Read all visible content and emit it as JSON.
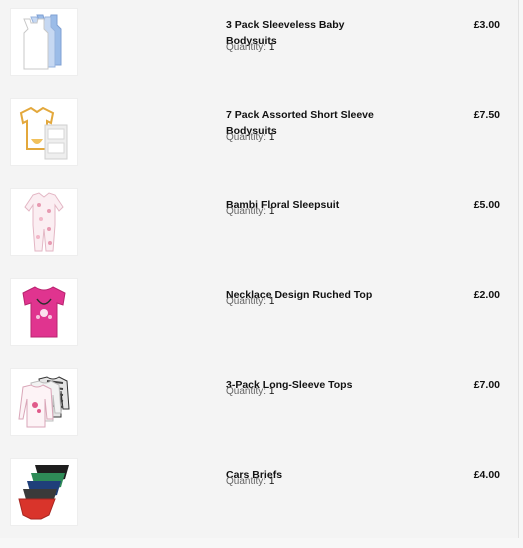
{
  "order": {
    "items": [
      {
        "name": "3 Pack Sleeveless Baby Bodysuits",
        "quantity_label": "Quantity:",
        "quantity": "1",
        "price": "£3.00",
        "image_icon": "white-blue-bodysuits-image"
      },
      {
        "name": "7 Pack Assorted Short Sleeve Bodysuits",
        "quantity_label": "Quantity:",
        "quantity": "1",
        "price": "£7.50",
        "image_icon": "short-sleeve-bodysuits-image"
      },
      {
        "name": "Bambi Floral Sleepsuit",
        "quantity_label": "Quantity:",
        "quantity": "1",
        "price": "£5.00",
        "image_icon": "floral-sleepsuit-image"
      },
      {
        "name": "Necklace Design Ruched Top",
        "quantity_label": "Quantity:",
        "quantity": "1",
        "price": "£2.00",
        "image_icon": "pink-top-image"
      },
      {
        "name": "3-Pack Long-Sleeve Tops",
        "quantity_label": "Quantity:",
        "quantity": "1",
        "price": "£7.00",
        "image_icon": "long-sleeve-tops-image"
      },
      {
        "name": "Cars Briefs",
        "quantity_label": "Quantity:",
        "quantity": "1",
        "price": "£4.00",
        "image_icon": "briefs-image"
      }
    ]
  },
  "colors": {
    "background": "#f4f4f4",
    "text": "#111111",
    "muted": "#666666",
    "accent_blue": "#8fb3e6",
    "accent_pink": "#e0348f",
    "accent_red": "#d9342b"
  }
}
